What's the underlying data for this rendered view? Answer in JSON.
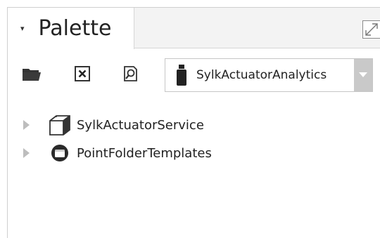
{
  "palette": {
    "tab": {
      "title": "Palette",
      "caret": "▾"
    },
    "toolbar": {
      "open_icon": "folder-open-icon",
      "close_icon": "close-box-icon",
      "find_icon": "find-icon"
    },
    "combo": {
      "selected": "SylkActuatorAnalytics",
      "icon": "jar-icon"
    },
    "tree": {
      "items": [
        {
          "label": "SylkActuatorService",
          "icon": "service-cube-icon"
        },
        {
          "label": "PointFolderTemplates",
          "icon": "folder-template-icon"
        }
      ]
    }
  }
}
